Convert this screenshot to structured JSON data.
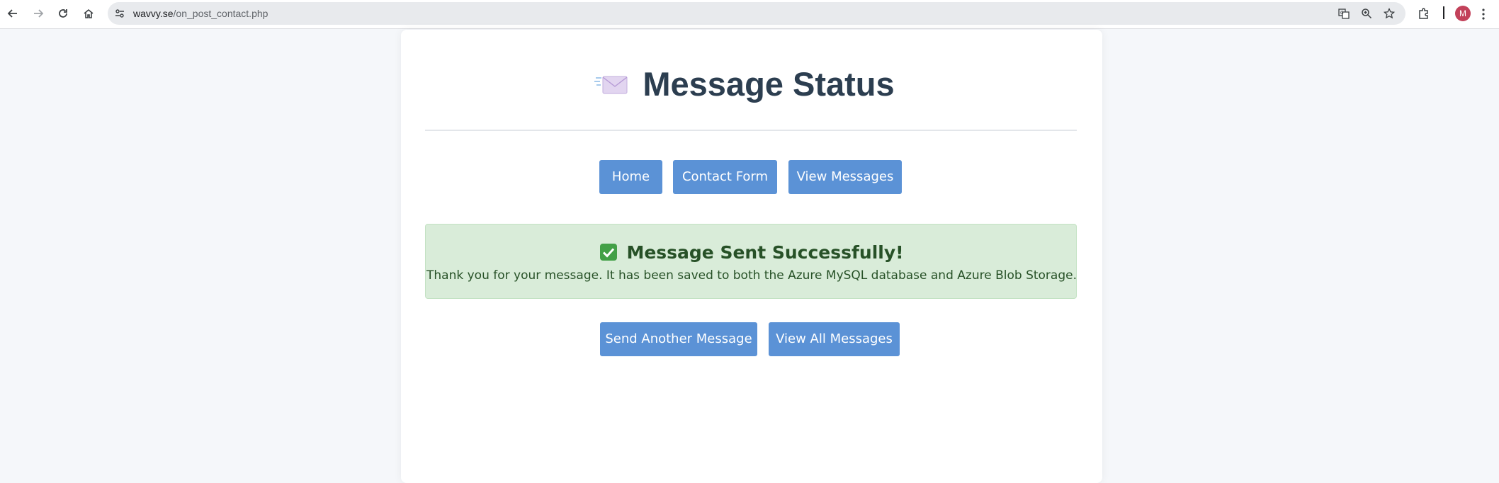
{
  "browser": {
    "url_host": "wavvy.se",
    "url_path": "/on_post_contact.php",
    "avatar_initial": "M",
    "icons": [
      "back-icon",
      "forward-icon",
      "reload-icon",
      "home-icon",
      "site-info-icon",
      "translate-icon",
      "zoom-icon",
      "bookmark-star-icon",
      "extensions-icon",
      "more-menu-icon"
    ]
  },
  "page": {
    "title": "Message Status",
    "title_icon": "envelope-icon",
    "nav_buttons": {
      "home": "Home",
      "contact_form": "Contact Form",
      "view_messages": "View Messages"
    },
    "alert": {
      "icon": "check-icon",
      "title": "Message Sent Successfully!",
      "text": "Thank you for your message. It has been saved to both the Azure MySQL database and Azure Blob Storage."
    },
    "action_buttons": {
      "send_another": "Send Another Message",
      "view_all": "View All Messages"
    }
  },
  "colors": {
    "button": "#5b92d6",
    "alert_bg": "#d9ecd9",
    "alert_text": "#275127",
    "title": "#2c3e50",
    "page_bg": "#f5f7fa"
  }
}
